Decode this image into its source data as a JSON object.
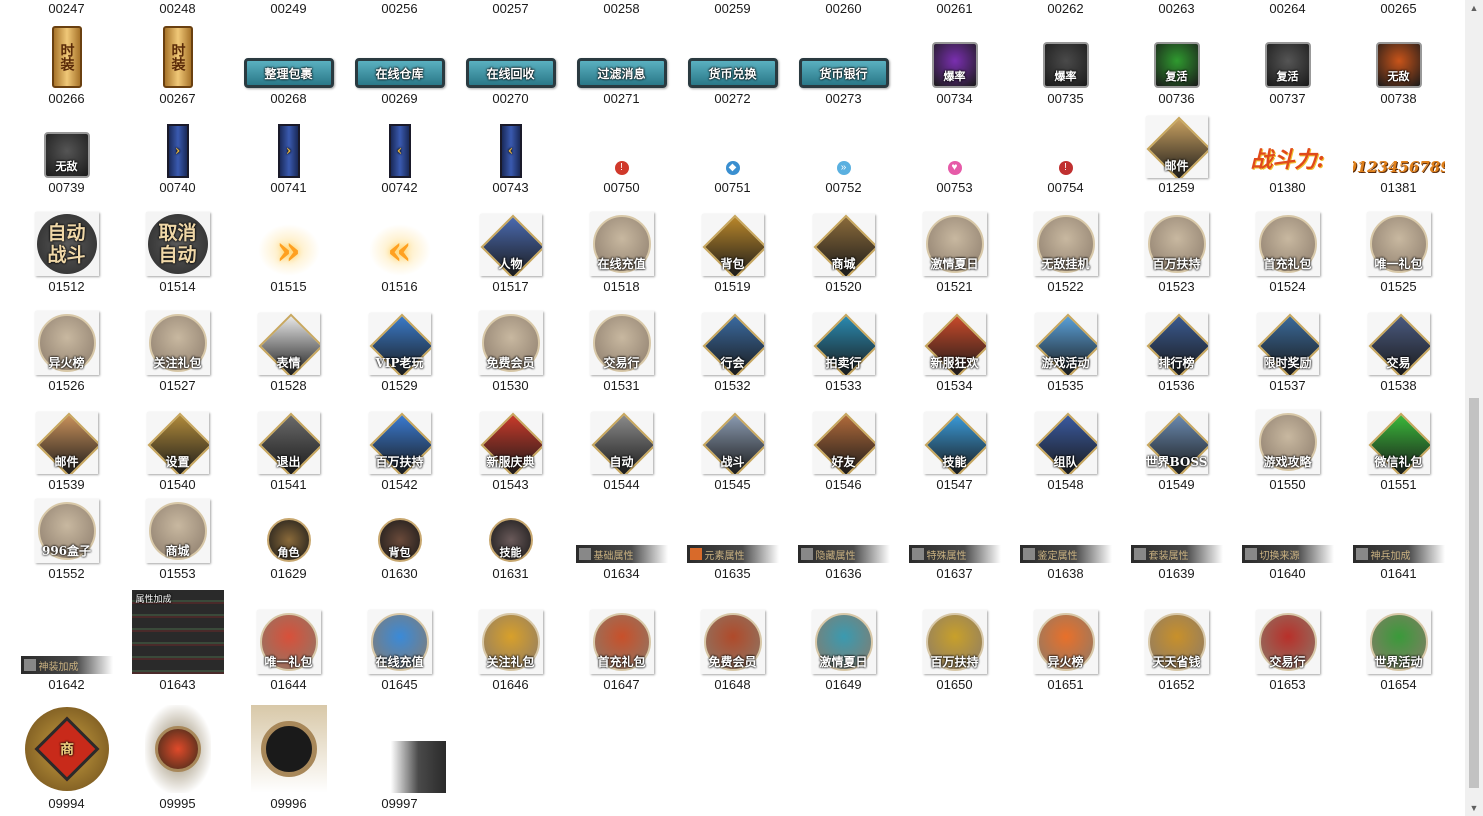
{
  "gallery": {
    "items": [
      {
        "name": "00247",
        "style": "none",
        "row": 0,
        "col": 0
      },
      {
        "name": "00248",
        "style": "none",
        "row": 0,
        "col": 1
      },
      {
        "name": "00249",
        "style": "none",
        "row": 0,
        "col": 2
      },
      {
        "name": "00256",
        "style": "none",
        "row": 0,
        "col": 3
      },
      {
        "name": "00257",
        "style": "none",
        "row": 0,
        "col": 4
      },
      {
        "name": "00258",
        "style": "none",
        "row": 0,
        "col": 5
      },
      {
        "name": "00259",
        "style": "none",
        "row": 0,
        "col": 6
      },
      {
        "name": "00260",
        "style": "none",
        "row": 0,
        "col": 7
      },
      {
        "name": "00261",
        "style": "none",
        "row": 0,
        "col": 8
      },
      {
        "name": "00262",
        "style": "none",
        "row": 0,
        "col": 9
      },
      {
        "name": "00263",
        "style": "none",
        "row": 0,
        "col": 10
      },
      {
        "name": "00264",
        "style": "none",
        "row": 0,
        "col": 11
      },
      {
        "name": "00265",
        "style": "none",
        "row": 0,
        "col": 12
      },
      {
        "name": "00266",
        "style": "scroll",
        "text": "时装",
        "row": 1,
        "col": 0
      },
      {
        "name": "00267",
        "style": "scroll",
        "text": "时装",
        "row": 1,
        "col": 1
      },
      {
        "name": "00268",
        "style": "plaque",
        "text": "整理包裹",
        "row": 1,
        "col": 2
      },
      {
        "name": "00269",
        "style": "plaque",
        "text": "在线仓库",
        "row": 1,
        "col": 3
      },
      {
        "name": "00270",
        "style": "plaque",
        "text": "在线回收",
        "row": 1,
        "col": 4
      },
      {
        "name": "00271",
        "style": "plaque",
        "text": "过滤消息",
        "row": 1,
        "col": 5
      },
      {
        "name": "00272",
        "style": "plaque",
        "text": "货币兑换",
        "row": 1,
        "col": 6
      },
      {
        "name": "00273",
        "style": "plaque",
        "text": "货币银行",
        "row": 1,
        "col": 7
      },
      {
        "name": "00734",
        "style": "square",
        "text": "爆率",
        "color": "#7a2fb0",
        "row": 1,
        "col": 8
      },
      {
        "name": "00735",
        "style": "square",
        "text": "爆率",
        "color": "#4a4a4a",
        "row": 1,
        "col": 9
      },
      {
        "name": "00736",
        "style": "square",
        "text": "复活",
        "color": "#2f9a2f",
        "row": 1,
        "col": 10
      },
      {
        "name": "00737",
        "style": "square",
        "text": "复活",
        "color": "#555555",
        "row": 1,
        "col": 11
      },
      {
        "name": "00738",
        "style": "square",
        "text": "无敌",
        "color": "#c8541a",
        "row": 1,
        "col": 12
      },
      {
        "name": "00739",
        "style": "square",
        "text": "无敌",
        "color": "#555555",
        "row": 2,
        "col": 0
      },
      {
        "name": "00740",
        "style": "bar",
        "text": "›",
        "row": 2,
        "col": 1
      },
      {
        "name": "00741",
        "style": "bar",
        "text": "›",
        "row": 2,
        "col": 2
      },
      {
        "name": "00742",
        "style": "bar",
        "text": "‹",
        "row": 2,
        "col": 3
      },
      {
        "name": "00743",
        "style": "bar",
        "text": "‹",
        "row": 2,
        "col": 4
      },
      {
        "name": "00750",
        "style": "small",
        "text": "!",
        "color": "#d0392b",
        "row": 2,
        "col": 5
      },
      {
        "name": "00751",
        "style": "small",
        "text": "◆",
        "color": "#3a8fd0",
        "row": 2,
        "col": 6
      },
      {
        "name": "00752",
        "style": "small",
        "text": "»",
        "color": "#5ab0e0",
        "row": 2,
        "col": 7
      },
      {
        "name": "00753",
        "style": "small",
        "text": "♥",
        "color": "#e65aa8",
        "row": 2,
        "col": 8
      },
      {
        "name": "00754",
        "style": "small",
        "text": "!",
        "color": "#c03030",
        "row": 2,
        "col": 9
      },
      {
        "name": "01259",
        "style": "diamond",
        "text": "邮件",
        "color": "#c8a060",
        "row": 2,
        "col": 10
      },
      {
        "name": "01380",
        "style": "fancy",
        "text": "战斗力:",
        "row": 2,
        "col": 11
      },
      {
        "name": "01381",
        "style": "digits",
        "text": "0123456789",
        "row": 2,
        "col": 12
      },
      {
        "name": "01512",
        "style": "darkround",
        "text": "自动\n战斗",
        "row": 3,
        "col": 0
      },
      {
        "name": "01514",
        "style": "darkround",
        "text": "取消\n自动",
        "row": 3,
        "col": 1
      },
      {
        "name": "01515",
        "style": "arrows",
        "text": "»",
        "row": 3,
        "col": 2
      },
      {
        "name": "01516",
        "style": "arrows",
        "text": "«",
        "row": 3,
        "col": 3
      },
      {
        "name": "01517",
        "style": "diamond",
        "text": "人物",
        "color": "#4a6ab0",
        "row": 3,
        "col": 4
      },
      {
        "name": "01518",
        "style": "round",
        "text": "在线充值",
        "color": "#c8b8a0",
        "row": 3,
        "col": 5
      },
      {
        "name": "01519",
        "style": "diamond",
        "text": "背包",
        "color": "#b8862a",
        "row": 3,
        "col": 6
      },
      {
        "name": "01520",
        "style": "diamond",
        "text": "商城",
        "color": "#8a6a3a",
        "row": 3,
        "col": 7
      },
      {
        "name": "01521",
        "style": "round",
        "text": "激情夏日",
        "color": "#c8b8a0",
        "row": 3,
        "col": 8
      },
      {
        "name": "01522",
        "style": "round",
        "text": "无敌挂机",
        "color": "#c8b8a0",
        "row": 3,
        "col": 9
      },
      {
        "name": "01523",
        "style": "round",
        "text": "百万扶持",
        "color": "#c8b8a0",
        "row": 3,
        "col": 10
      },
      {
        "name": "01524",
        "style": "round",
        "text": "首充礼包",
        "color": "#c8b8a0",
        "row": 3,
        "col": 11
      },
      {
        "name": "01525",
        "style": "round",
        "text": "唯一礼包",
        "color": "#c8b8a0",
        "row": 3,
        "col": 12
      },
      {
        "name": "01526",
        "style": "round",
        "text": "异火榜",
        "color": "#c8b8a0",
        "row": 4,
        "col": 0
      },
      {
        "name": "01527",
        "style": "round",
        "text": "关注礼包",
        "color": "#c8b8a0",
        "row": 4,
        "col": 1
      },
      {
        "name": "01528",
        "style": "diamond",
        "text": "表情",
        "color": "#e8e8e8",
        "row": 4,
        "col": 2
      },
      {
        "name": "01529",
        "style": "diamond",
        "text": "VIP老玩",
        "color": "#3a7ac8",
        "row": 4,
        "col": 3
      },
      {
        "name": "01530",
        "style": "round",
        "text": "免费会员",
        "color": "#c8b8a0",
        "row": 4,
        "col": 4
      },
      {
        "name": "01531",
        "style": "round",
        "text": "交易行",
        "color": "#c8b8a0",
        "row": 4,
        "col": 5
      },
      {
        "name": "01532",
        "style": "diamond",
        "text": "行会",
        "color": "#3a6aa0",
        "row": 4,
        "col": 6
      },
      {
        "name": "01533",
        "style": "diamond",
        "text": "拍卖行",
        "color": "#2a8ab0",
        "row": 4,
        "col": 7
      },
      {
        "name": "01534",
        "style": "diamond",
        "text": "新服狂欢",
        "color": "#c84a2a",
        "row": 4,
        "col": 8
      },
      {
        "name": "01535",
        "style": "diamond",
        "text": "游戏活动",
        "color": "#5aa0d8",
        "row": 4,
        "col": 9
      },
      {
        "name": "01536",
        "style": "diamond",
        "text": "排行榜",
        "color": "#3a5a90",
        "row": 4,
        "col": 10
      },
      {
        "name": "01537",
        "style": "diamond",
        "text": "限时奖励",
        "color": "#3a6a9a",
        "row": 4,
        "col": 11
      },
      {
        "name": "01538",
        "style": "diamond",
        "text": "交易",
        "color": "#4a5a80",
        "row": 4,
        "col": 12
      },
      {
        "name": "01539",
        "style": "diamond",
        "text": "邮件",
        "color": "#c8905a",
        "row": 5,
        "col": 0
      },
      {
        "name": "01540",
        "style": "diamond",
        "text": "设置",
        "color": "#b08a3a",
        "row": 5,
        "col": 1
      },
      {
        "name": "01541",
        "style": "diamond",
        "text": "退出",
        "color": "#6a6a6a",
        "row": 5,
        "col": 2
      },
      {
        "name": "01542",
        "style": "diamond",
        "text": "百万扶持",
        "color": "#3a7ad0",
        "row": 5,
        "col": 3
      },
      {
        "name": "01543",
        "style": "diamond",
        "text": "新服庆典",
        "color": "#c83a2a",
        "row": 5,
        "col": 4
      },
      {
        "name": "01544",
        "style": "diamond",
        "text": "自动",
        "color": "#8a8a8a",
        "row": 5,
        "col": 5
      },
      {
        "name": "01545",
        "style": "diamond",
        "text": "战斗",
        "color": "#8a9ab0",
        "row": 5,
        "col": 6
      },
      {
        "name": "01546",
        "style": "diamond",
        "text": "好友",
        "color": "#b06a3a",
        "row": 5,
        "col": 7
      },
      {
        "name": "01547",
        "style": "diamond",
        "text": "技能",
        "color": "#3a9ad8",
        "row": 5,
        "col": 8
      },
      {
        "name": "01548",
        "style": "diamond",
        "text": "组队",
        "color": "#3a5aa0",
        "row": 5,
        "col": 9
      },
      {
        "name": "01549",
        "style": "diamond",
        "text": "世界BOSS",
        "color": "#6a8ab0",
        "row": 5,
        "col": 10
      },
      {
        "name": "01550",
        "style": "round",
        "text": "游戏攻略",
        "color": "#c8b8a0",
        "row": 5,
        "col": 11
      },
      {
        "name": "01551",
        "style": "diamond",
        "text": "微信礼包",
        "color": "#3ab83a",
        "row": 5,
        "col": 12
      },
      {
        "name": "01552",
        "style": "round",
        "text": "996盒子",
        "color": "#c8b8a0",
        "row": 6,
        "col": 0
      },
      {
        "name": "01553",
        "style": "round",
        "text": "商城",
        "color": "#c8b8a0",
        "row": 6,
        "col": 1
      },
      {
        "name": "01629",
        "style": "miniround",
        "text": "角色",
        "color": "#8a6a3a",
        "row": 6,
        "col": 2
      },
      {
        "name": "01630",
        "style": "miniround",
        "text": "背包",
        "color": "#6a4a3a",
        "row": 6,
        "col": 3
      },
      {
        "name": "01631",
        "style": "miniround",
        "text": "技能",
        "color": "#6a5a5a",
        "row": 6,
        "col": 4
      },
      {
        "name": "01634",
        "style": "tab",
        "text": "基础属性",
        "color": "#888888",
        "row": 6,
        "col": 5
      },
      {
        "name": "01635",
        "style": "tab",
        "text": "元素属性",
        "color": "#d86a2a",
        "row": 6,
        "col": 6
      },
      {
        "name": "01636",
        "style": "tab",
        "text": "隐藏属性",
        "color": "#888888",
        "row": 6,
        "col": 7
      },
      {
        "name": "01637",
        "style": "tab",
        "text": "特殊属性",
        "color": "#888888",
        "row": 6,
        "col": 8
      },
      {
        "name": "01638",
        "style": "tab",
        "text": "鉴定属性",
        "color": "#888888",
        "row": 6,
        "col": 9
      },
      {
        "name": "01639",
        "style": "tab",
        "text": "套装属性",
        "color": "#888888",
        "row": 6,
        "col": 10
      },
      {
        "name": "01640",
        "style": "tab",
        "text": "切换来源",
        "color": "#888888",
        "row": 6,
        "col": 11
      },
      {
        "name": "01641",
        "style": "tab",
        "text": "神兵加成",
        "color": "#888888",
        "row": 6,
        "col": 12
      },
      {
        "name": "01642",
        "style": "tab",
        "text": "神装加成",
        "color": "#888888",
        "row": 7,
        "col": 0
      },
      {
        "name": "01643",
        "style": "panel",
        "text": "属性加成",
        "row": 7,
        "col": 1
      },
      {
        "name": "01644",
        "style": "round",
        "text": "唯一礼包",
        "color": "#d8503a",
        "row": 7,
        "col": 2
      },
      {
        "name": "01645",
        "style": "round",
        "text": "在线充值",
        "color": "#3a8ad8",
        "row": 7,
        "col": 3
      },
      {
        "name": "01646",
        "style": "round",
        "text": "关注礼包",
        "color": "#d8a02a",
        "row": 7,
        "col": 4
      },
      {
        "name": "01647",
        "style": "round",
        "text": "首充礼包",
        "color": "#c8502a",
        "row": 7,
        "col": 5
      },
      {
        "name": "01648",
        "style": "round",
        "text": "免费会员",
        "color": "#b04a2a",
        "row": 7,
        "col": 6
      },
      {
        "name": "01649",
        "style": "round",
        "text": "激情夏日",
        "color": "#3a9ab0",
        "row": 7,
        "col": 7
      },
      {
        "name": "01650",
        "style": "round",
        "text": "百万扶持",
        "color": "#c8a02a",
        "row": 7,
        "col": 8
      },
      {
        "name": "01651",
        "style": "round",
        "text": "异火榜",
        "color": "#e8702a",
        "row": 7,
        "col": 9
      },
      {
        "name": "01652",
        "style": "round",
        "text": "天天省钱",
        "color": "#c8902a",
        "row": 7,
        "col": 10
      },
      {
        "name": "01653",
        "style": "round",
        "text": "交易行",
        "color": "#b8302a",
        "row": 7,
        "col": 11
      },
      {
        "name": "01654",
        "style": "round",
        "text": "世界活动",
        "color": "#3a9a3a",
        "row": 7,
        "col": 12
      },
      {
        "name": "09994",
        "style": "bigemblem",
        "text": "商",
        "row": 8,
        "col": 0
      },
      {
        "name": "09995",
        "style": "cluster",
        "text": "",
        "row": 8,
        "col": 1
      },
      {
        "name": "09996",
        "style": "frame",
        "text": "",
        "row": 8,
        "col": 2
      },
      {
        "name": "09997",
        "style": "dragon",
        "text": "",
        "row": 8,
        "col": 3
      }
    ]
  },
  "scrollbar": {
    "up_icon": "triangle-up-icon",
    "down_icon": "triangle-down-icon"
  }
}
